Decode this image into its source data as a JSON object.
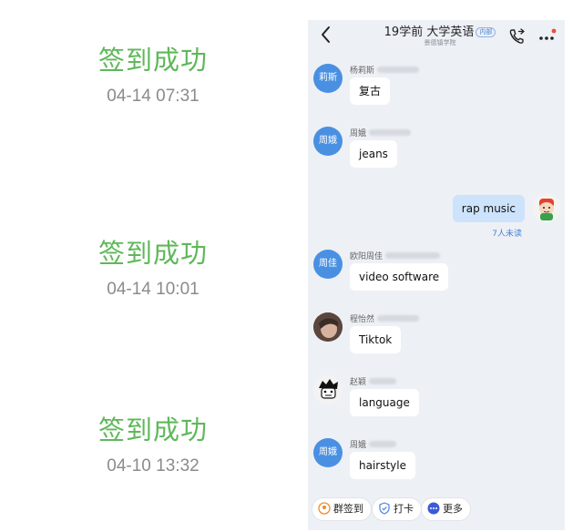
{
  "checkins": [
    {
      "title": "签到成功",
      "time": "04-14 07:31"
    },
    {
      "title": "签到成功",
      "time": "04-14 10:01"
    },
    {
      "title": "签到成功",
      "time": "04-10 13:32"
    }
  ],
  "chat": {
    "title": "19学前 大学英语",
    "tag": "内部",
    "subtitle": "景德镇学院",
    "messages": [
      {
        "avatar_text": "莉斯",
        "sender": "杨莉斯",
        "text": "复古"
      },
      {
        "avatar_text": "周娥",
        "sender": "周娥",
        "text": "jeans"
      },
      {
        "text": "rap music",
        "read_status": "7人未读"
      },
      {
        "avatar_text": "周佳",
        "sender": "欧阳周佳",
        "text": "video software"
      },
      {
        "sender": "程怡然",
        "text": "Tiktok"
      },
      {
        "sender": "赵颖",
        "text": "language"
      },
      {
        "avatar_text": "周娥",
        "sender": "周娥",
        "text": "hairstyle"
      }
    ],
    "actions": [
      "群签到",
      "打卡",
      "更多"
    ]
  },
  "colors": {
    "success_green": "#5fb85a",
    "avatar_blue": "#4a90e2",
    "my_bubble": "#cce3fb",
    "chat_bg": "#edf0f5"
  }
}
